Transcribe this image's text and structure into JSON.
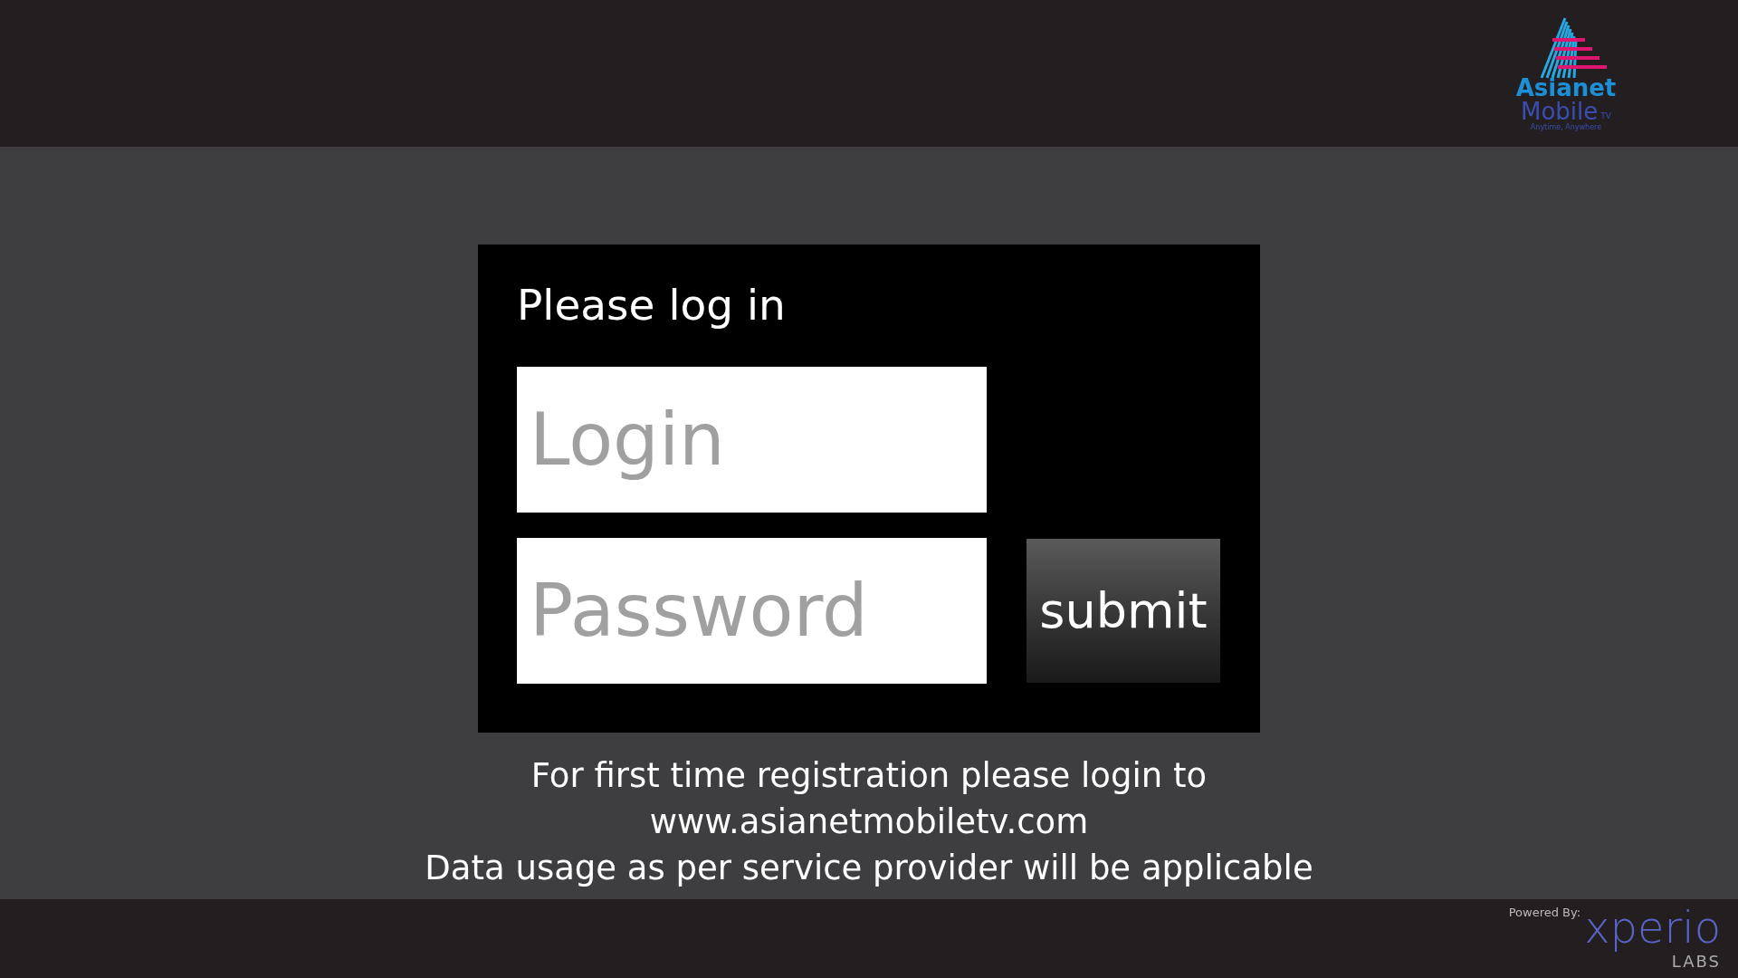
{
  "header": {
    "logo": {
      "brand": "Asianet",
      "product": "Mobile",
      "suffix": "TV",
      "tagline": "Anytime, Anywhere"
    }
  },
  "login_card": {
    "title": "Please log in",
    "login_field": {
      "placeholder": "Login"
    },
    "password_field": {
      "placeholder": "Password"
    },
    "submit_button": "submit"
  },
  "info_lines": [
    "For first time registration please login to",
    "www.asianetmobiletv.com",
    "Data usage as per service provider will be applicable"
  ],
  "footer": {
    "powered_by": "Powered By:",
    "brand": "xperio",
    "brand_sub": "LABS"
  }
}
